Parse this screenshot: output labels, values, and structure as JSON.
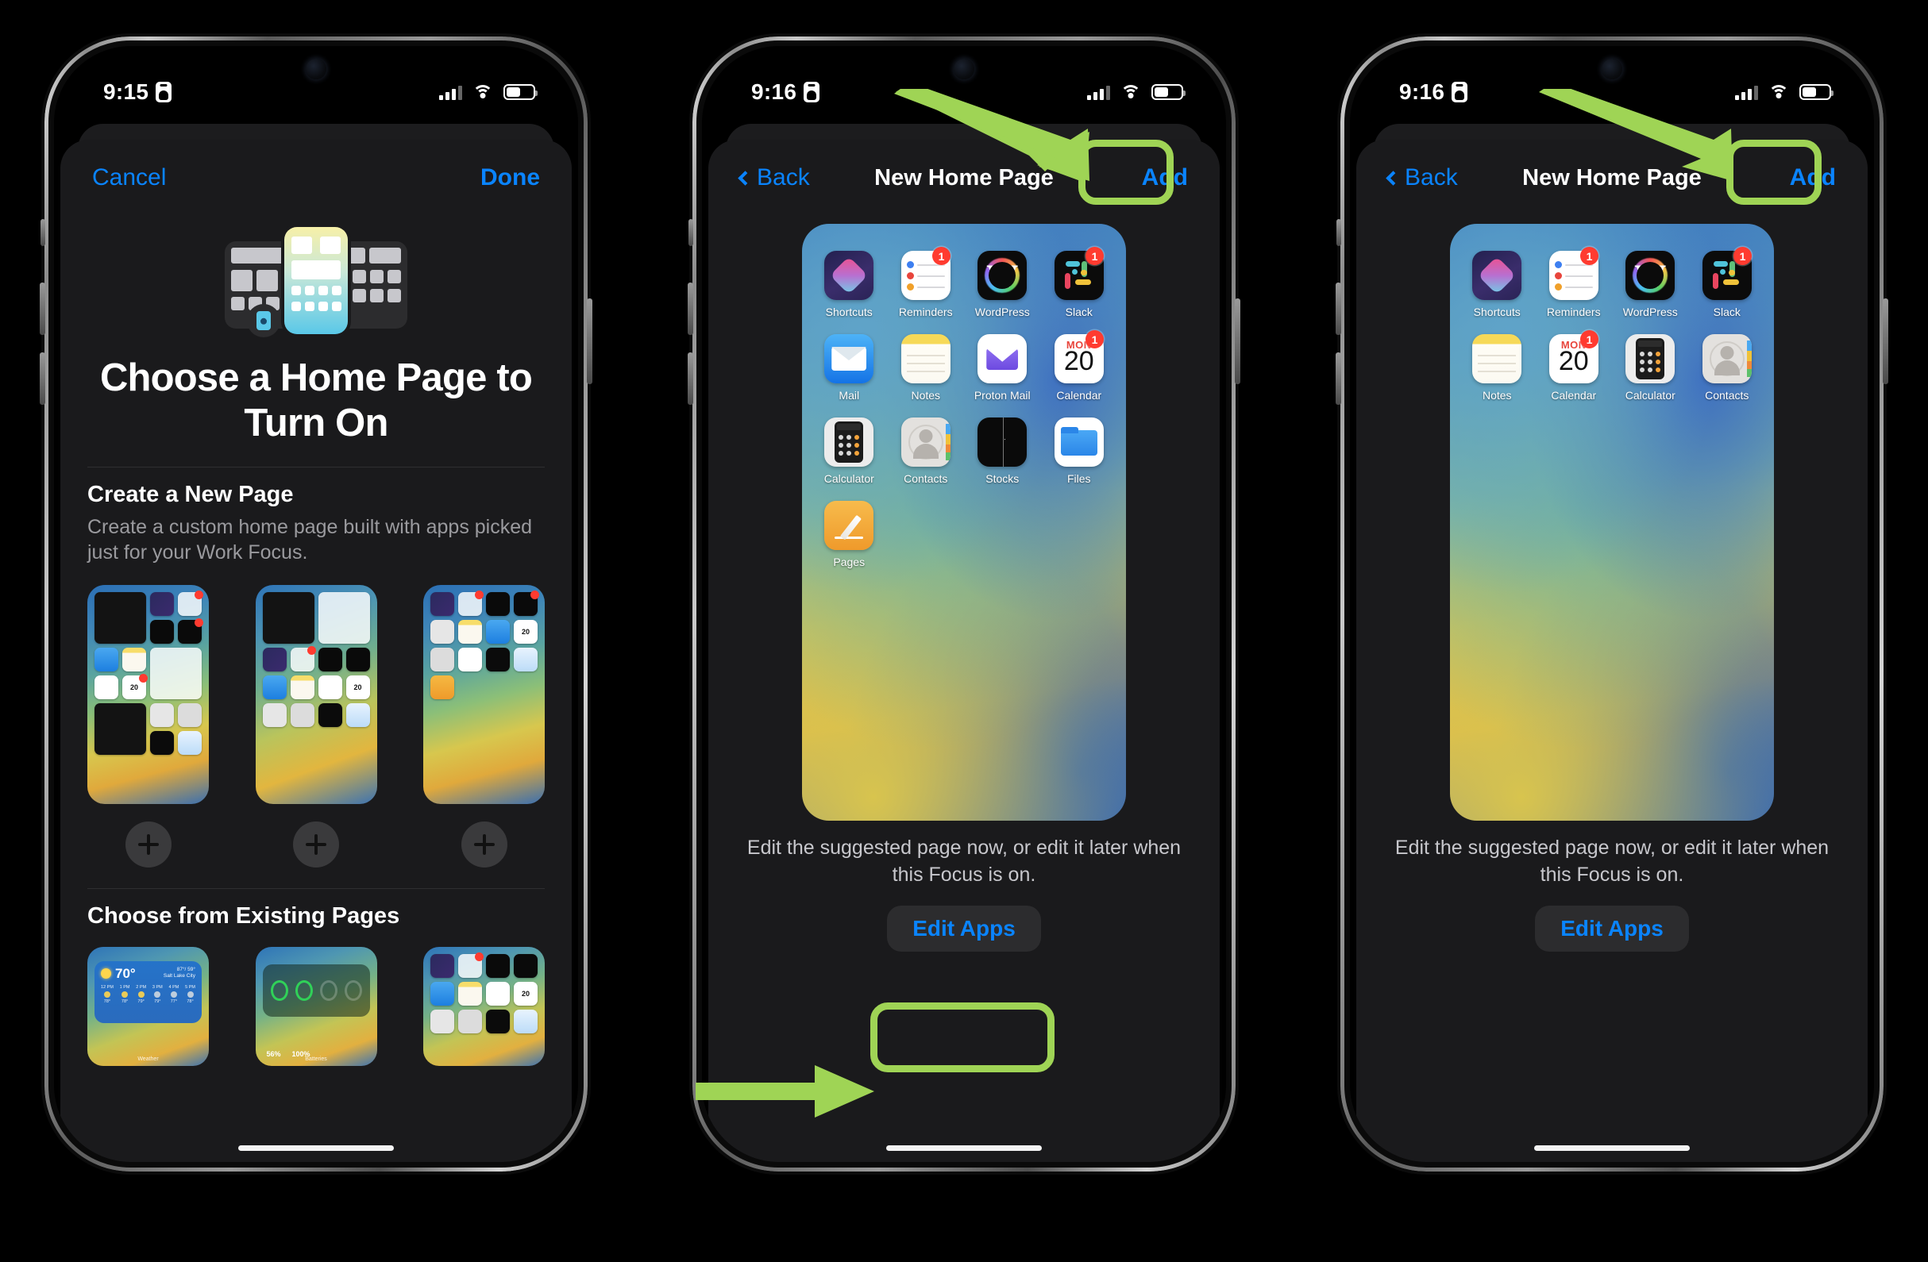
{
  "annotation": {
    "color": "#9fd455"
  },
  "phones": [
    {
      "id": "phone-1",
      "status": {
        "time": "9:15",
        "focus_icon": "focus-id-card-icon",
        "signal_icon": "cellular-signal-icon",
        "wifi_icon": "wifi-icon",
        "battery_icon": "battery-icon"
      },
      "nav": {
        "left_label": "Cancel",
        "right_label": "Done",
        "title": ""
      },
      "hero": {
        "title": "Choose a Home Page to Turn On",
        "illustration": "home-screen-pages-illustration"
      },
      "create_section": {
        "title": "Create a New Page",
        "description": "Create a custom home page built with apps picked just for your Work Focus.",
        "suggestions": [
          {
            "name": "suggested-page-1"
          },
          {
            "name": "suggested-page-2"
          },
          {
            "name": "suggested-page-3"
          }
        ],
        "add_button_label": "+"
      },
      "existing_section": {
        "title": "Choose from Existing Pages",
        "pages": [
          {
            "name": "weather-page",
            "widget": {
              "temp": "70°",
              "city": "Salt Lake City",
              "hi_lo": "87°/ 59°",
              "label": "Weather",
              "hours": [
                {
                  "t": "12 PM",
                  "v": "78°"
                },
                {
                  "t": "1 PM",
                  "v": "78°"
                },
                {
                  "t": "2 PM",
                  "v": "79°"
                },
                {
                  "t": "3 PM",
                  "v": "79°"
                },
                {
                  "t": "4 PM",
                  "v": "77°"
                },
                {
                  "t": "5 PM",
                  "v": "78°"
                }
              ]
            }
          },
          {
            "name": "batteries-page",
            "widget": {
              "label": "Batteries",
              "values": [
                "56%",
                "100%"
              ]
            }
          },
          {
            "name": "apps-page",
            "widget": {
              "label": ""
            }
          }
        ]
      }
    },
    {
      "id": "phone-2",
      "status": {
        "time": "9:16",
        "focus_icon": "focus-id-card-icon",
        "signal_icon": "cellular-signal-icon",
        "wifi_icon": "wifi-icon",
        "battery_icon": "battery-icon"
      },
      "nav": {
        "back_label": "Back",
        "title": "New Home Page",
        "right_label": "Add"
      },
      "home_preview": {
        "apps": [
          {
            "label": "Shortcuts",
            "icon": "shortcuts-icon",
            "badge": ""
          },
          {
            "label": "Reminders",
            "icon": "reminders-icon",
            "badge": "1"
          },
          {
            "label": "WordPress",
            "icon": "wordpress-icon",
            "badge": ""
          },
          {
            "label": "Slack",
            "icon": "slack-icon",
            "badge": "1"
          },
          {
            "label": "Mail",
            "icon": "mail-icon",
            "badge": ""
          },
          {
            "label": "Notes",
            "icon": "notes-icon",
            "badge": ""
          },
          {
            "label": "Proton Mail",
            "icon": "proton-mail-icon",
            "badge": ""
          },
          {
            "label": "Calendar",
            "icon": "calendar-icon",
            "badge": "1",
            "cal_month": "MON",
            "cal_day": "20"
          },
          {
            "label": "Calculator",
            "icon": "calculator-icon",
            "badge": ""
          },
          {
            "label": "Contacts",
            "icon": "contacts-icon",
            "badge": ""
          },
          {
            "label": "Stocks",
            "icon": "stocks-icon",
            "badge": ""
          },
          {
            "label": "Files",
            "icon": "files-icon",
            "badge": ""
          },
          {
            "label": "Pages",
            "icon": "pages-icon",
            "badge": ""
          }
        ]
      },
      "help_text": "Edit the suggested page now, or edit it later when this Focus is on.",
      "edit_apps_label": "Edit Apps",
      "highlights": [
        "add-button",
        "edit-apps-button"
      ]
    },
    {
      "id": "phone-3",
      "status": {
        "time": "9:16",
        "focus_icon": "focus-id-card-icon",
        "signal_icon": "cellular-signal-icon",
        "wifi_icon": "wifi-icon",
        "battery_icon": "battery-icon"
      },
      "nav": {
        "back_label": "Back",
        "title": "New Home Page",
        "right_label": "Add"
      },
      "home_preview": {
        "apps": [
          {
            "label": "Shortcuts",
            "icon": "shortcuts-icon",
            "badge": ""
          },
          {
            "label": "Reminders",
            "icon": "reminders-icon",
            "badge": "1"
          },
          {
            "label": "WordPress",
            "icon": "wordpress-icon",
            "badge": ""
          },
          {
            "label": "Slack",
            "icon": "slack-icon",
            "badge": "1"
          },
          {
            "label": "Notes",
            "icon": "notes-icon",
            "badge": ""
          },
          {
            "label": "Calendar",
            "icon": "calendar-icon",
            "badge": "1",
            "cal_month": "MON",
            "cal_day": "20"
          },
          {
            "label": "Calculator",
            "icon": "calculator-icon",
            "badge": ""
          },
          {
            "label": "Contacts",
            "icon": "contacts-icon",
            "badge": ""
          }
        ]
      },
      "help_text": "Edit the suggested page now, or edit it later when this Focus is on.",
      "edit_apps_label": "Edit Apps",
      "highlights": [
        "add-button"
      ]
    }
  ]
}
